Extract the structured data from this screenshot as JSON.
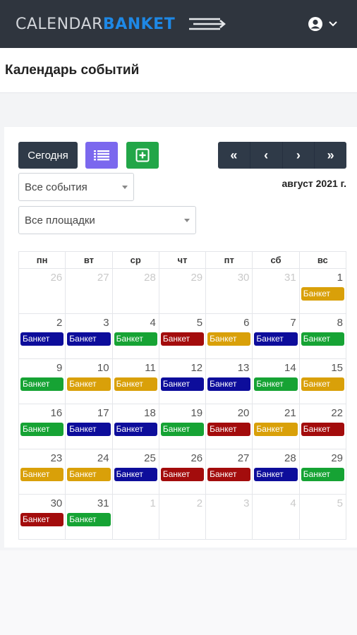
{
  "brand": {
    "part1": "CALENDAR",
    "part2": "BANKET"
  },
  "page_title": "Календарь событий",
  "toolbar": {
    "today_label": "Сегодня"
  },
  "nav": [
    "«",
    "‹",
    "›",
    "»"
  ],
  "filters": {
    "events": "Все события",
    "venues": "Все площадки"
  },
  "month_label": "август 2021 г.",
  "event_label": "Банкет",
  "colors": {
    "blue": "#0d0d9b",
    "green": "#16a334",
    "gold": "#d9a009",
    "red": "#a30c0c",
    "dark": "#2f353e",
    "purple": "#7b68ee"
  },
  "calendar": {
    "weekdays": [
      "пн",
      "вт",
      "ср",
      "чт",
      "пт",
      "сб",
      "вс"
    ],
    "weeks": [
      [
        {
          "d": "26",
          "o": true
        },
        {
          "d": "27",
          "o": true
        },
        {
          "d": "28",
          "o": true
        },
        {
          "d": "29",
          "o": true
        },
        {
          "d": "30",
          "o": true
        },
        {
          "d": "31",
          "o": true
        },
        {
          "d": "1",
          "e": "gold"
        }
      ],
      [
        {
          "d": "2",
          "e": "blue"
        },
        {
          "d": "3",
          "e": "blue"
        },
        {
          "d": "4",
          "e": "green"
        },
        {
          "d": "5",
          "e": "red"
        },
        {
          "d": "6",
          "e": "gold"
        },
        {
          "d": "7",
          "e": "blue"
        },
        {
          "d": "8",
          "e": "green"
        }
      ],
      [
        {
          "d": "9",
          "e": "green"
        },
        {
          "d": "10",
          "e": "gold"
        },
        {
          "d": "11",
          "e": "gold"
        },
        {
          "d": "12",
          "e": "blue"
        },
        {
          "d": "13",
          "e": "blue"
        },
        {
          "d": "14",
          "e": "green"
        },
        {
          "d": "15",
          "e": "gold"
        }
      ],
      [
        {
          "d": "16",
          "e": "green"
        },
        {
          "d": "17",
          "e": "blue"
        },
        {
          "d": "18",
          "e": "blue"
        },
        {
          "d": "19",
          "e": "green"
        },
        {
          "d": "20",
          "e": "red"
        },
        {
          "d": "21",
          "e": "gold"
        },
        {
          "d": "22",
          "e": "red"
        }
      ],
      [
        {
          "d": "23",
          "e": "gold"
        },
        {
          "d": "24",
          "e": "gold"
        },
        {
          "d": "25",
          "e": "blue"
        },
        {
          "d": "26",
          "e": "red"
        },
        {
          "d": "27",
          "e": "red"
        },
        {
          "d": "28",
          "e": "blue"
        },
        {
          "d": "29",
          "e": "green"
        }
      ],
      [
        {
          "d": "30",
          "e": "red"
        },
        {
          "d": "31",
          "e": "green"
        },
        {
          "d": "1",
          "o": true
        },
        {
          "d": "2",
          "o": true
        },
        {
          "d": "3",
          "o": true
        },
        {
          "d": "4",
          "o": true
        },
        {
          "d": "5",
          "o": true
        }
      ]
    ]
  }
}
